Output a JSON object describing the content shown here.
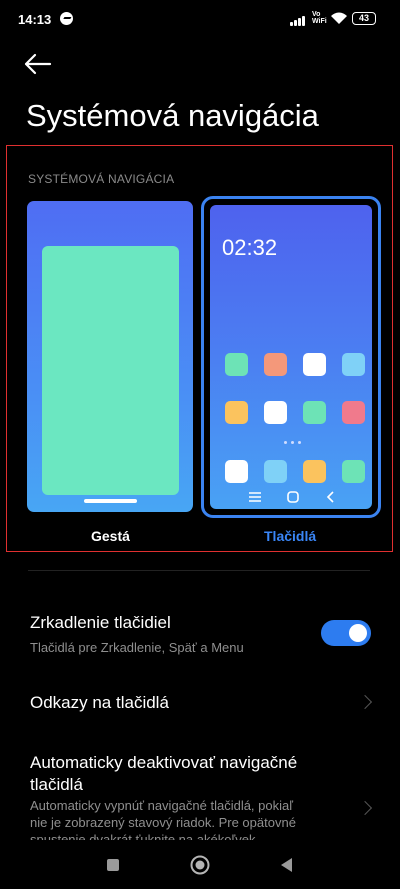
{
  "status_bar": {
    "time": "14:13",
    "messenger_icon": "messenger-icon",
    "signal_icon": "signal-icon",
    "volte_line1": "Vo",
    "volte_line2": "WiFi",
    "wifi_icon": "wifi-icon",
    "battery": "43"
  },
  "header": {
    "back_icon": "back-arrow-icon",
    "title": "Systémová navigácia"
  },
  "navigation_picker": {
    "section_label": "SYSTÉMOVÁ NAVIGÁCIA",
    "preview_clock": "02:32",
    "options": [
      {
        "label": "Gestá",
        "selected": false
      },
      {
        "label": "Tlačidlá",
        "selected": true
      }
    ],
    "app_icon_colors": [
      [
        "#6de3b6",
        "#f4987a",
        "#ffffff",
        "#7fd1f7"
      ],
      [
        "#fbc35e",
        "#ffffff",
        "#6de3b6",
        "#f07a8c"
      ],
      [
        "#ffffff",
        "#7fd1f7",
        "#fbc35e",
        "#6de3b6"
      ]
    ]
  },
  "settings": {
    "mirror_buttons": {
      "title": "Zrkadlenie tlačidiel",
      "subtitle": "Tlačidlá pre Zrkadlenie, Späť a Menu",
      "enabled": true
    },
    "shortcuts": {
      "title": "Odkazy na tlačidlá"
    },
    "auto_disable": {
      "title_line1": "Automaticky deaktivovať navigačné",
      "title_line2": "tlačidlá",
      "subtitle_line1": "Automaticky vypnúť navigačné tlačidlá, pokiaľ",
      "subtitle_line2": "nie je zobrazený stavový riadok. Pre opätovné",
      "subtitle_line3": "spustenie dvakrát ťuknite na akékoľvek"
    }
  },
  "system_nav": {
    "recents_icon": "square-icon",
    "home_icon": "circle-home-icon",
    "back_icon": "triangle-back-icon"
  },
  "colors": {
    "accent": "#3a86f7",
    "toggle_on": "#2d7cf0",
    "background": "#000000",
    "secondary_text": "#8f8f8f"
  }
}
